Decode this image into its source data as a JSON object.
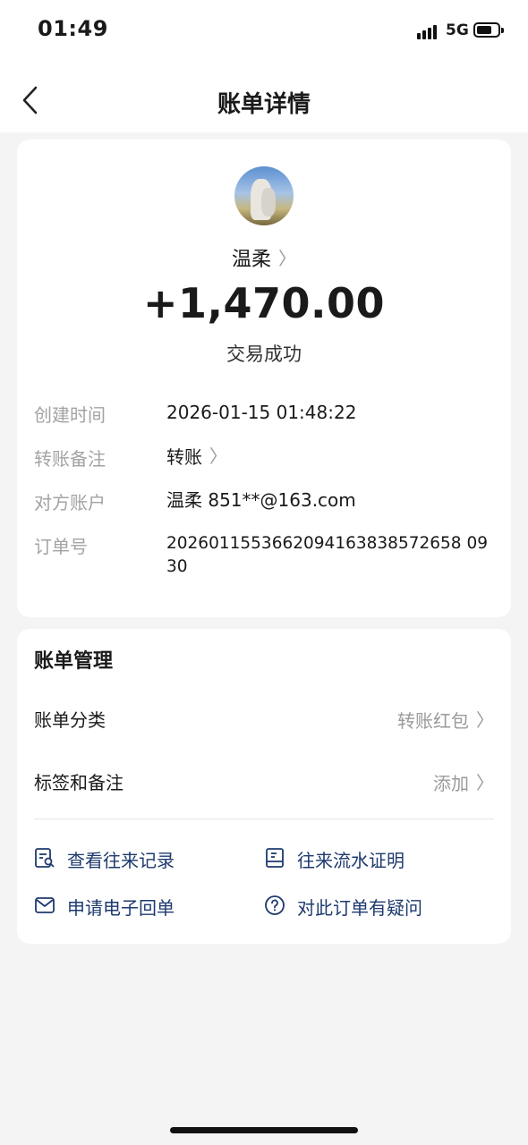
{
  "status_bar": {
    "time": "01:49",
    "network": "5G"
  },
  "nav": {
    "title": "账单详情"
  },
  "payee": {
    "name": "温柔"
  },
  "amount": "+1,470.00",
  "status": "交易成功",
  "details": [
    {
      "label": "创建时间",
      "value": "2026-01-15 01:48:22"
    },
    {
      "label": "转账备注",
      "value": "转账"
    },
    {
      "label": "对方账户",
      "value": "温柔 851**@163.com"
    },
    {
      "label": "订单号",
      "value": "2026011553662094163838572658 0930"
    }
  ],
  "management": {
    "title": "账单管理",
    "rows": [
      {
        "label": "账单分类",
        "value": "转账红包"
      },
      {
        "label": "标签和备注",
        "value": "添加"
      }
    ],
    "actions": [
      {
        "label": "查看往来记录",
        "icon": "record-search-icon"
      },
      {
        "label": "往来流水证明",
        "icon": "statement-icon"
      },
      {
        "label": "申请电子回单",
        "icon": "mail-icon"
      },
      {
        "label": "对此订单有疑问",
        "icon": "question-icon"
      }
    ]
  },
  "colors": {
    "action_blue": "#1e3a6e",
    "label_gray": "#a3a3a3",
    "background": "#f4f4f4"
  }
}
